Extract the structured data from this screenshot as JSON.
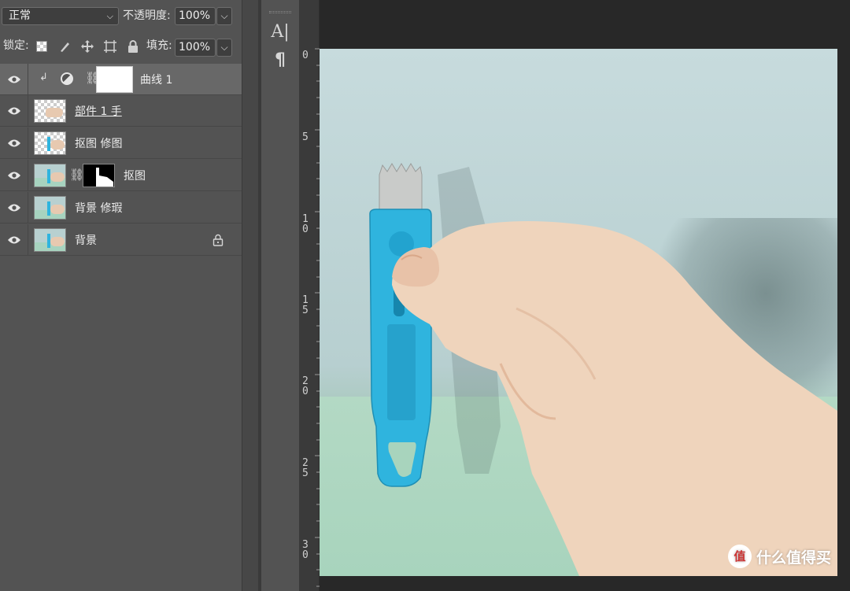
{
  "layers_panel": {
    "blend_mode": "正常",
    "opacity_label": "不透明度:",
    "opacity_value": "100%",
    "lock_label": "锁定:",
    "fill_label": "填充:",
    "fill_value": "100%",
    "layers": [
      {
        "name": "曲线 1",
        "type": "adjustment",
        "active": true
      },
      {
        "name": "部件 1 手",
        "type": "transparent",
        "underlined": true
      },
      {
        "name": "抠图 修图",
        "type": "transparent"
      },
      {
        "name": "抠图",
        "type": "photo-with-mask"
      },
      {
        "name": "背景 修瑕",
        "type": "photo"
      },
      {
        "name": "背景",
        "type": "photo",
        "locked": true
      }
    ]
  },
  "toolbar": {
    "text_tool": "A|",
    "paragraph_tool": "¶"
  },
  "ruler": {
    "marks": [
      "0",
      "5",
      "1\n0",
      "1\n5",
      "2\n0",
      "2\n5",
      "3\n0"
    ]
  },
  "watermark": {
    "text": "什么值得买",
    "logo": "值"
  },
  "colors": {
    "panel": "#535353",
    "canvas_bg": "#282828",
    "cutter_blue": "#2fb4de"
  }
}
